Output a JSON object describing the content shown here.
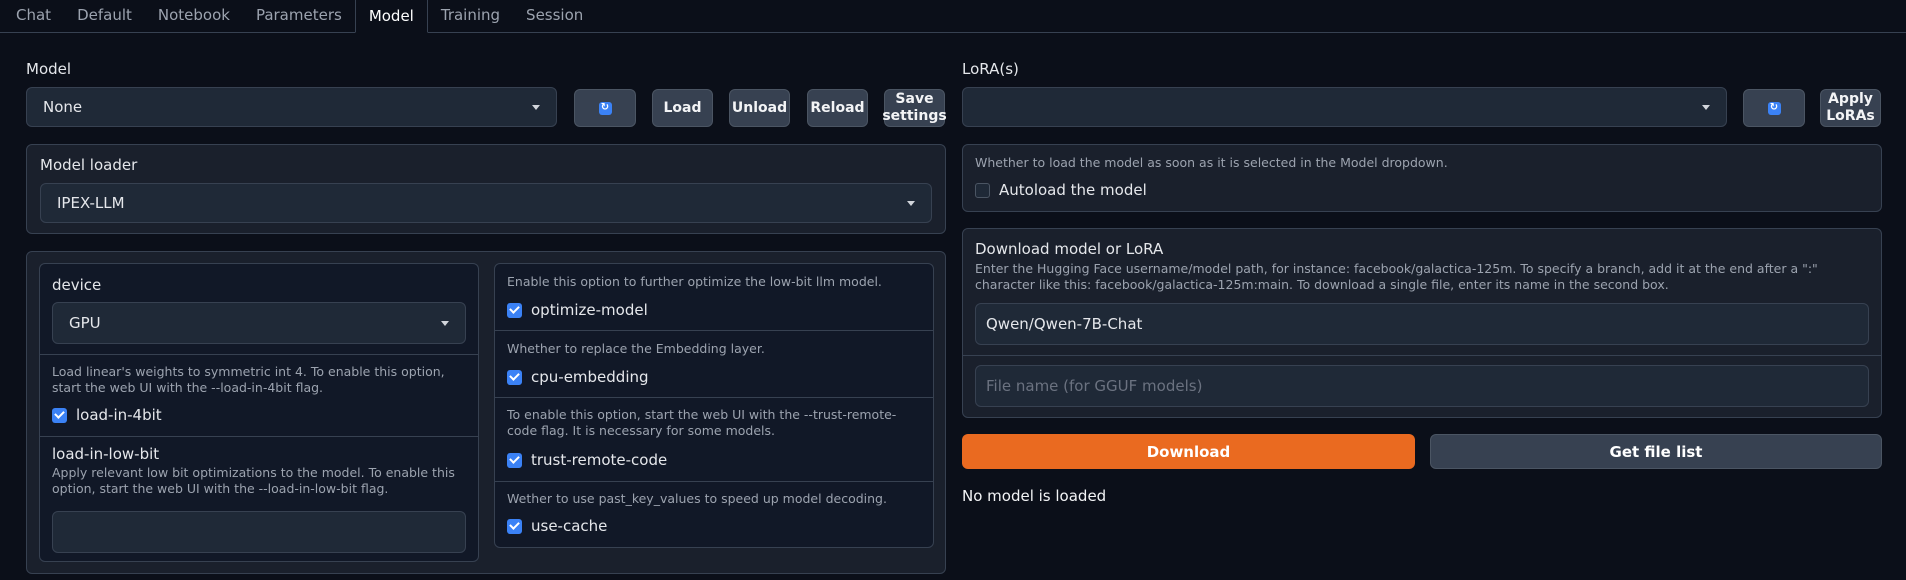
{
  "tabs": [
    {
      "label": "Chat"
    },
    {
      "label": "Default"
    },
    {
      "label": "Notebook"
    },
    {
      "label": "Parameters"
    },
    {
      "label": "Model"
    },
    {
      "label": "Training"
    },
    {
      "label": "Session"
    }
  ],
  "model": {
    "label": "Model",
    "selected": "None",
    "refresh_icon": "refresh-icon",
    "load_label": "Load",
    "unload_label": "Unload",
    "reload_label": "Reload",
    "save_settings_label": "Save settings"
  },
  "lora": {
    "label": "LoRA(s)",
    "selected": "",
    "apply_label": "Apply LoRAs"
  },
  "loader": {
    "label": "Model loader",
    "selected": "IPEX-LLM"
  },
  "left_options": {
    "device_label": "device",
    "device_value": "GPU",
    "load_in_4bit_info": "Load linear's weights to symmetric int 4. To enable this option, start the web UI with the --load-in-4bit flag.",
    "load_in_4bit_label": "load-in-4bit",
    "load_in_4bit_checked": true,
    "low_bit_label": "load-in-low-bit",
    "low_bit_info": "Apply relevant low bit optimizations to the model. To enable this option, start the web UI with the --load-in-low-bit flag.",
    "low_bit_value": ""
  },
  "right_options": [
    {
      "info": "Enable this option to further optimize the low-bit llm model.",
      "label": "optimize-model",
      "checked": true
    },
    {
      "info": "Whether to replace the Embedding layer.",
      "label": "cpu-embedding",
      "checked": true
    },
    {
      "info": "To enable this option, start the web UI with the --trust-remote-code flag. It is necessary for some models.",
      "label": "trust-remote-code",
      "checked": true
    },
    {
      "info": "Wether to use past_key_values to speed up model decoding.",
      "label": "use-cache",
      "checked": true
    }
  ],
  "autoload": {
    "info": "Whether to load the model as soon as it is selected in the Model dropdown.",
    "label": "Autoload the model",
    "checked": false
  },
  "download": {
    "title": "Download model or LoRA",
    "info": "Enter the Hugging Face username/model path, for instance: facebook/galactica-125m. To specify a branch, add it at the end after a \":\" character like this: facebook/galactica-125m:main. To download a single file, enter its name in the second box.",
    "model_path_value": "Qwen/Qwen-7B-Chat",
    "filename_placeholder": "File name (for GGUF models)",
    "download_label": "Download",
    "get_file_list_label": "Get file list",
    "status": "No model is loaded"
  },
  "colors": {
    "accent": "#3b82f6",
    "primary_button": "#ea6a20",
    "background": "#0b0f19"
  }
}
